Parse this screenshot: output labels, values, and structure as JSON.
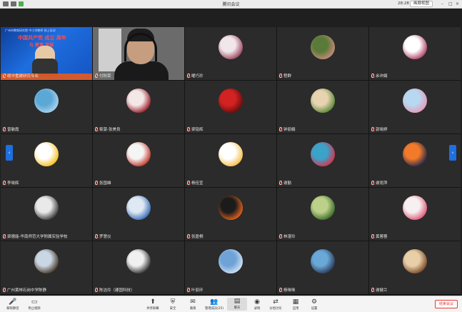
{
  "window": {
    "title": "腾讯会议",
    "time": "28:28",
    "view_label": "画廊视图"
  },
  "slide": {
    "head": "广州市教育研究院 中小学教师 线上培训",
    "title": "中国共产党 成立 周年",
    "subtitle": "与 教育 发展"
  },
  "participants": [
    {
      "name": "缆中重建研究专业",
      "avatar": "slide"
    },
    {
      "name": "付秋荣",
      "avatar": "camera"
    },
    {
      "name": "曜巧珍",
      "avatar": "photo",
      "colors": [
        "#f1e6ea",
        "#9c4a5e"
      ]
    },
    {
      "name": "程群",
      "avatar": "photo",
      "colors": [
        "#5a7a3a",
        "#c88a7a"
      ]
    },
    {
      "name": "余沛娟",
      "avatar": "photo",
      "colors": [
        "#ffffff",
        "#b0436a"
      ]
    },
    {
      "name": "曾敏霞",
      "avatar": "photo",
      "colors": [
        "#5ba7d6",
        "#a9d3ee"
      ]
    },
    {
      "name": "筱菠-张美良",
      "avatar": "photo",
      "colors": [
        "#f3e7e7",
        "#9a1f2a"
      ]
    },
    {
      "name": "梁铭辉",
      "avatar": "photo",
      "colors": [
        "#d32222",
        "#6b0d0d"
      ]
    },
    {
      "name": "钟丽娟",
      "avatar": "photo",
      "colors": [
        "#e8d3b0",
        "#5b8a3a"
      ]
    },
    {
      "name": "郭晓婷",
      "avatar": "photo",
      "colors": [
        "#b7d8f0",
        "#e89ab8"
      ]
    },
    {
      "name": "李晓辉",
      "avatar": "photo",
      "colors": [
        "#ffffff",
        "#f2c21b"
      ]
    },
    {
      "name": "张国雄",
      "avatar": "photo",
      "colors": [
        "#f5f5f5",
        "#c0392b"
      ]
    },
    {
      "name": "杨佳宜",
      "avatar": "photo",
      "colors": [
        "#ffffff",
        "#f6c04a"
      ]
    },
    {
      "name": "谢勤",
      "avatar": "photo",
      "colors": [
        "#3aa3c9",
        "#d8324d"
      ]
    },
    {
      "name": "谢雨萍",
      "avatar": "photo",
      "colors": [
        "#f27a2a",
        "#2a2a4a"
      ]
    },
    {
      "name": "梁德能-华南师范大学附属实验学校",
      "avatar": "photo",
      "colors": [
        "#e9e9e9",
        "#3b3b3b"
      ]
    },
    {
      "name": "罗慧仪",
      "avatar": "photo",
      "colors": [
        "#dfe8f3",
        "#3b6fb8"
      ]
    },
    {
      "name": "张盈桐",
      "avatar": "photo",
      "colors": [
        "#1b1b1b",
        "#e3611c"
      ]
    },
    {
      "name": "林漫玲",
      "avatar": "photo",
      "colors": [
        "#bcd08a",
        "#3c6b2a"
      ]
    },
    {
      "name": "黄蓉蓉",
      "avatar": "photo",
      "colors": [
        "#f6f1f0",
        "#e05a7b"
      ]
    },
    {
      "name": "广州黄林石岗中学陈静",
      "avatar": "photo",
      "colors": [
        "#c9d6e3",
        "#4a3a2a"
      ]
    },
    {
      "name": "陈洁玲（建国科技）",
      "avatar": "photo",
      "colors": [
        "#f0f0f0",
        "#333333"
      ]
    },
    {
      "name": "叶丽环",
      "avatar": "photo",
      "colors": [
        "#6fa2d6",
        "#cfe2f5"
      ]
    },
    {
      "name": "杨咪咪",
      "avatar": "photo",
      "colors": [
        "#6aa8d8",
        "#2b3b55"
      ]
    },
    {
      "name": "谢健兰",
      "avatar": "photo",
      "colors": [
        "#e8cfa8",
        "#7a4a2a"
      ]
    }
  ],
  "toolbar": {
    "items": [
      {
        "label": "解除静音",
        "icon": "mic-muted-icon",
        "glyph": "🎤"
      },
      {
        "label": "停止视频",
        "icon": "video-icon",
        "glyph": "▭"
      },
      {
        "label": "共享屏幕",
        "icon": "share-screen-icon",
        "glyph": "⬆"
      },
      {
        "label": "安全",
        "icon": "shield-icon",
        "glyph": "⛨"
      },
      {
        "label": "邀请",
        "icon": "invite-icon",
        "glyph": "✉"
      },
      {
        "label": "管理成员(25)",
        "icon": "members-icon",
        "glyph": "👥"
      },
      {
        "label": "聊天",
        "icon": "chat-icon",
        "glyph": "▤"
      },
      {
        "label": "录制",
        "icon": "record-icon",
        "glyph": "◉"
      },
      {
        "label": "分组讨论",
        "icon": "breakout-icon",
        "glyph": "⇄"
      },
      {
        "label": "应用",
        "icon": "apps-icon",
        "glyph": "▦"
      },
      {
        "label": "设置",
        "icon": "gear-icon",
        "glyph": "⚙"
      }
    ],
    "end_label": "结束会议"
  }
}
